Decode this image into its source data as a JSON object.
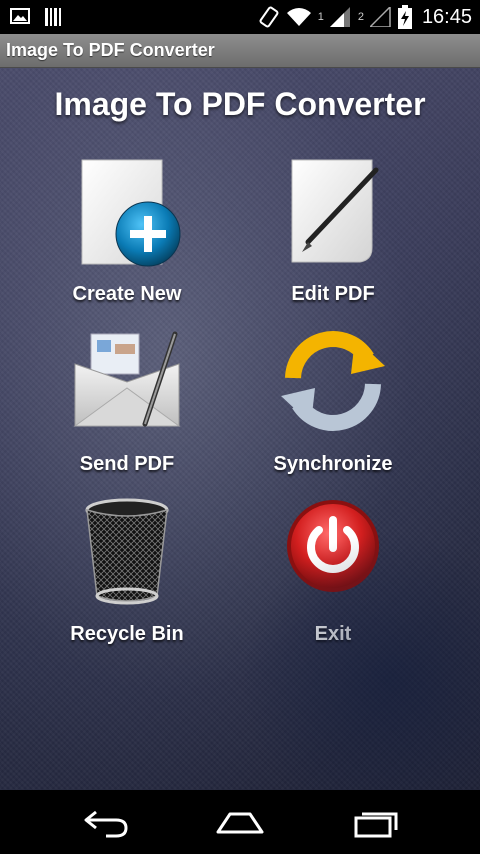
{
  "status_bar": {
    "time": "16:45",
    "sim1_label": "1",
    "sim2_label": "2",
    "icons": [
      "gallery-icon",
      "barcode-icon",
      "rotate-icon",
      "wifi-icon",
      "signal-icon",
      "battery-icon"
    ]
  },
  "app_bar": {
    "title": "Image To PDF Converter"
  },
  "main": {
    "heading": "Image To PDF Converter",
    "tiles": [
      {
        "label": "Create New",
        "icon": "document-add-icon"
      },
      {
        "label": "Edit PDF",
        "icon": "document-pen-icon"
      },
      {
        "label": "Send PDF",
        "icon": "envelope-icon"
      },
      {
        "label": "Synchronize",
        "icon": "sync-icon"
      },
      {
        "label": "Recycle Bin",
        "icon": "trash-bin-icon"
      },
      {
        "label": "Exit",
        "icon": "power-icon"
      }
    ]
  },
  "nav_bar": {
    "icons": [
      "back-icon",
      "home-icon",
      "recent-apps-icon"
    ]
  },
  "colors": {
    "accent_blue": "#1a8fc4",
    "sync_yellow": "#f4b400",
    "exit_red": "#d31f1f"
  }
}
